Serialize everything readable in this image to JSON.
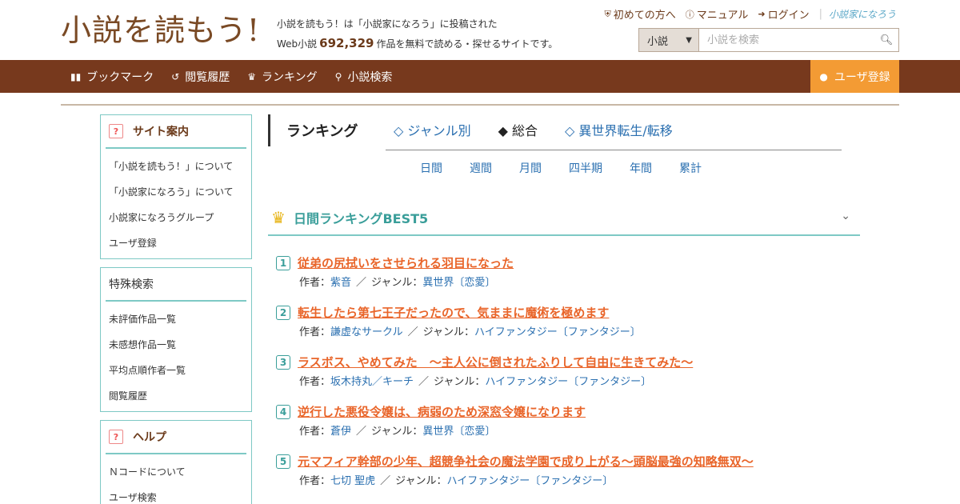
{
  "header": {
    "logo": "小説を読もう!",
    "tagline_line1": "小説を読もう！は「小説家になろう」に投稿された",
    "tagline_prefix": "Web小説",
    "tagline_count": "692,329",
    "tagline_suffix": "作品を無料で読める・探せるサイトです。",
    "links": [
      {
        "label": "初めての方へ",
        "icon": "shield-icon"
      },
      {
        "label": "マニュアル",
        "icon": "question-circle-icon"
      },
      {
        "label": "ログイン",
        "icon": "login-icon"
      }
    ],
    "brand": "小説家になろう",
    "search": {
      "select_value": "小説",
      "placeholder": "小説を検索"
    }
  },
  "nav": {
    "items": [
      {
        "label": "ブックマーク",
        "icon": "bookmark-icon"
      },
      {
        "label": "閲覧履歴",
        "icon": "history-icon"
      },
      {
        "label": "ランキング",
        "icon": "crown-icon"
      },
      {
        "label": "小説検索",
        "icon": "search-icon"
      }
    ],
    "register": "ユーザ登録"
  },
  "sidebar": {
    "site_guide": {
      "title": "サイト案内",
      "items": [
        "「小説を読もう！」について",
        "「小説家になろう」について",
        "小説家になろうグループ",
        "ユーザ登録"
      ]
    },
    "special_search": {
      "title": "特殊検索",
      "items": [
        "未評価作品一覧",
        "未感想作品一覧",
        "平均点順作者一覧",
        "閲覧履歴"
      ]
    },
    "help": {
      "title": "ヘルプ",
      "items": [
        "Ｎコードについて",
        "ユーザ検索"
      ]
    }
  },
  "main": {
    "title": "ランキング",
    "tabs": [
      {
        "label": "◇ ジャンル別",
        "active": false
      },
      {
        "label": "◆ 総合",
        "active": true
      },
      {
        "label": "◇ 異世界転生/転移",
        "active": false
      }
    ],
    "periods": [
      "日間",
      "週間",
      "月間",
      "四半期",
      "年間",
      "累計"
    ],
    "ranking_title": "日間ランキングBEST5",
    "author_label": "作者：",
    "genre_label": "ジャンル：",
    "separator": "／",
    "entries": [
      {
        "rank": "1",
        "title": "従弟の尻拭いをさせられる羽目になった",
        "author": "紫音",
        "genre": "異世界〔恋愛〕"
      },
      {
        "rank": "2",
        "title": "転生したら第七王子だったので、気ままに魔術を極めます",
        "author": "謙虚なサークル",
        "genre": "ハイファンタジー〔ファンタジー〕"
      },
      {
        "rank": "3",
        "title": "ラスボス、やめてみた　～主人公に倒されたふりして自由に生きてみた～",
        "author": "坂木持丸／キーチ",
        "genre": "ハイファンタジー〔ファンタジー〕"
      },
      {
        "rank": "4",
        "title": "逆行した悪役令嬢は、病弱のため深窓令嬢になります",
        "author": "蒼伊",
        "genre": "異世界〔恋愛〕"
      },
      {
        "rank": "5",
        "title": "元マフィア幹部の少年、超競争社会の魔法学園で成り上がる～頭脳最強の知略無双～",
        "author": "七切 聖虎",
        "genre": "ハイファンタジー〔ファンタジー〕"
      }
    ]
  }
}
